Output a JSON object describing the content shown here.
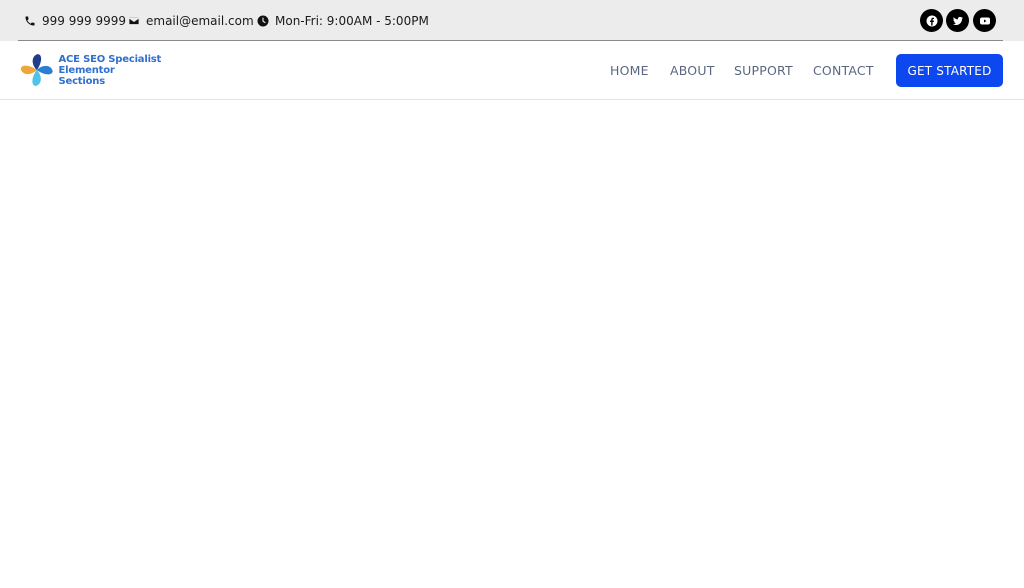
{
  "topbar": {
    "phone": "999 999 9999",
    "email": "email@email.com",
    "hours": "Mon-Fri: 9:00AM - 5:00PM",
    "phone_icon": "phone-icon",
    "email_icon": "envelope-icon",
    "hours_icon": "clock-icon",
    "social": [
      "facebook-icon",
      "twitter-icon",
      "youtube-icon"
    ]
  },
  "header": {
    "logo_line1": "ACE SEO Specialist",
    "logo_line2": "Elementor Sections",
    "nav": [
      "HOME",
      "ABOUT",
      "SUPPORT",
      "CONTACT"
    ],
    "cta_label": "GET STARTED"
  },
  "colors": {
    "topbar_bg": "#ececec",
    "accent": "#0c47f0",
    "nav_text": "#5b6780",
    "logo_text": "#2f6fd0"
  }
}
